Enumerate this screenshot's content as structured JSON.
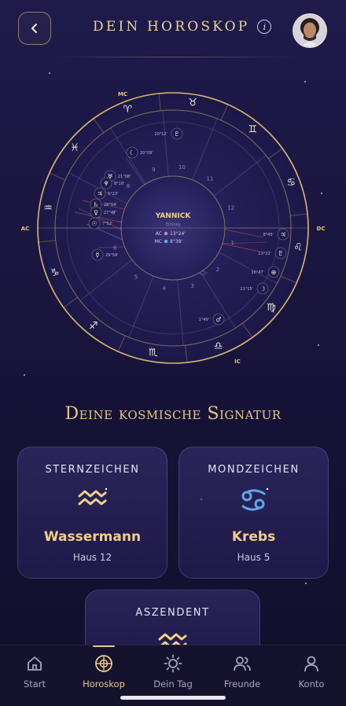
{
  "header": {
    "title": "DEIN HOROSKOP",
    "info_label": "i"
  },
  "chart": {
    "center_name": "YANNICK",
    "center_sub": "Eintrag",
    "ac_label": "AC",
    "ac_value": "13°24'",
    "mc_label": "MC",
    "mc_value": "8°38'",
    "axis_labels": {
      "mc": "MC",
      "ac": "AC",
      "dc": "DC",
      "ic": "IC"
    },
    "house_numbers": [
      "1",
      "2",
      "3",
      "4",
      "5",
      "6",
      "7",
      "8",
      "9",
      "10",
      "11",
      "12"
    ],
    "planet_degrees": [
      "20°12'",
      "20°09'",
      "21°08'",
      "8°18'",
      "5°23'",
      "28°54'",
      "27°47'",
      "7°52'",
      "29°54'",
      "8°45'",
      "23°22'",
      "16°47'",
      "11°15'",
      "1°49'"
    ]
  },
  "section": {
    "title": "Deine kosmische Signatur"
  },
  "cards": {
    "sun": {
      "label": "STERNZEICHEN",
      "value": "Wassermann",
      "house": "Haus 12",
      "icon": "aquarius-icon"
    },
    "moon": {
      "label": "MONDZEICHEN",
      "value": "Krebs",
      "house": "Haus 5",
      "icon": "cancer-icon"
    },
    "asc": {
      "label": "ASZENDENT",
      "icon": "aquarius-icon"
    }
  },
  "nav": {
    "items": [
      {
        "label": "Start",
        "icon": "home-icon"
      },
      {
        "label": "Horoskop",
        "icon": "horoscope-icon"
      },
      {
        "label": "Dein Tag",
        "icon": "sun-icon"
      },
      {
        "label": "Freunde",
        "icon": "friends-icon"
      },
      {
        "label": "Konto",
        "icon": "account-icon"
      }
    ],
    "active": "Horoskop"
  },
  "colors": {
    "accent": "#e7c684",
    "background": "#1a1640",
    "aspect_red": "#c8556b",
    "aspect_blue": "#6d8fd8"
  }
}
